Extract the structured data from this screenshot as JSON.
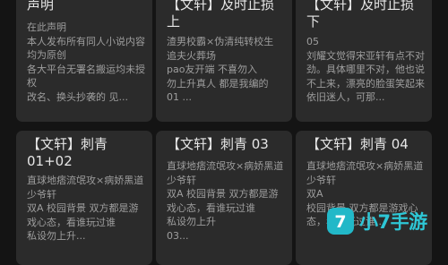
{
  "cards": [
    {
      "title": "声明",
      "body": "在此声明\n本人发布所有同人小说内容均为原创\n各大平台无署名搬运均未授权\n改名、换头抄袭的 见..."
    },
    {
      "title": "【文轩】及时止损\n上",
      "body": "渣男校霸×伪清纯转校生\n追夫火葬场\npao友开端 不喜勿入\n勿上升真人 都是我编的\n01 ..."
    },
    {
      "title": "【文轩】及时止损\n下",
      "body": "05\n刘耀文觉得宋亚轩有点不对劲。具体哪里不对，他也说不上来，漂亮的脸蛋笑起来依旧迷人，可那..."
    },
    {
      "title": "【文轩】刺青\n01+02",
      "body": "直球地痞流氓攻×病娇黑道少爷轩\n双A 校园背景 双方都是游戏心态，看谁玩过谁\n私设勿上升..."
    },
    {
      "title": "【文轩】刺青 03",
      "body": "直球地痞流氓攻×病娇黑道少爷轩\n双A 校园背景 双方都是游戏心态，看谁玩过谁\n私设勿上升\n03..."
    },
    {
      "title": "【文轩】刺青 04",
      "body": "直球地痞流氓攻×病娇黑道少爷轩\n双A\n校园背景 双方都是游戏心态，看谁玩过谁..."
    }
  ],
  "watermark": {
    "logo_glyph": "7",
    "text": "小7手游",
    "color": "#2ec7d6"
  }
}
